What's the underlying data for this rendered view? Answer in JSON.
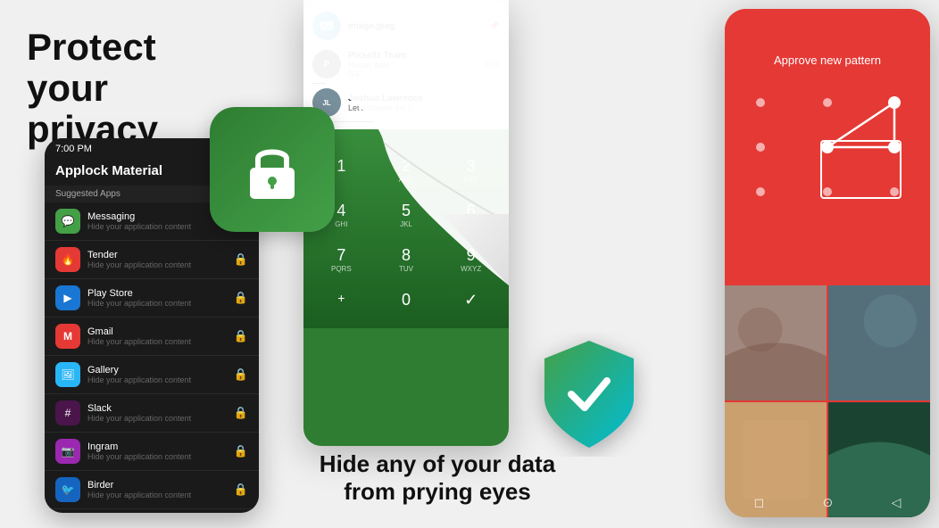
{
  "hero": {
    "title_line1": "Protect your",
    "title_line2": "privacy"
  },
  "phone_left": {
    "status_time": "7:00 PM",
    "app_name": "Applock Material",
    "section_label": "Suggested Apps",
    "apps": [
      {
        "name": "Messaging",
        "desc": "Hide your application content",
        "color": "#43a047",
        "icon": "💬"
      },
      {
        "name": "Tender",
        "desc": "Hide your application content",
        "color": "#e53935",
        "icon": "🔥"
      },
      {
        "name": "Play Store",
        "desc": "Hide your application content",
        "color": "#1976d2",
        "icon": "▶"
      },
      {
        "name": "Gmail",
        "desc": "Hide your application content",
        "color": "#e53935",
        "icon": "M"
      },
      {
        "name": "Gallery",
        "desc": "Hide your application content",
        "color": "#29b6f6",
        "icon": "🖼"
      },
      {
        "name": "Slack",
        "desc": "Hide your application content",
        "color": "#4a154b",
        "icon": "#"
      },
      {
        "name": "Ingram",
        "desc": "Hide your application content",
        "color": "#9c27b0",
        "icon": "📷"
      },
      {
        "name": "Birder",
        "desc": "Hide your application content",
        "color": "#1565c0",
        "icon": "🐦"
      }
    ]
  },
  "phone_middle": {
    "messages": [
      {
        "name": "image.jpeg",
        "text": "",
        "is_file": true
      },
      {
        "name": "Pixsellz Team",
        "sub": "Hasan Web",
        "text": "GIF",
        "badge": "9/29"
      },
      {
        "name": "Joshua Lawrence",
        "text": "Let's choose the f..."
      }
    ],
    "keypad": [
      {
        "num": "1",
        "letters": ""
      },
      {
        "num": "2",
        "letters": "ABC"
      },
      {
        "num": "3",
        "letters": "DEF"
      },
      {
        "num": "4",
        "letters": "GHI"
      },
      {
        "num": "5",
        "letters": "JKL"
      },
      {
        "num": "6",
        "letters": "MNO"
      },
      {
        "num": "7",
        "letters": "PQRS"
      },
      {
        "num": "8",
        "letters": "TUV"
      },
      {
        "num": "9",
        "letters": "WXYZ"
      },
      {
        "num": "+",
        "letters": ""
      },
      {
        "num": "0",
        "letters": ""
      },
      {
        "num": "✓",
        "letters": ""
      }
    ]
  },
  "phone_right": {
    "approve_text": "Approve new pattern"
  },
  "bottom_cta": {
    "line1": "Hide any of your data",
    "line2": "from prying eyes"
  }
}
